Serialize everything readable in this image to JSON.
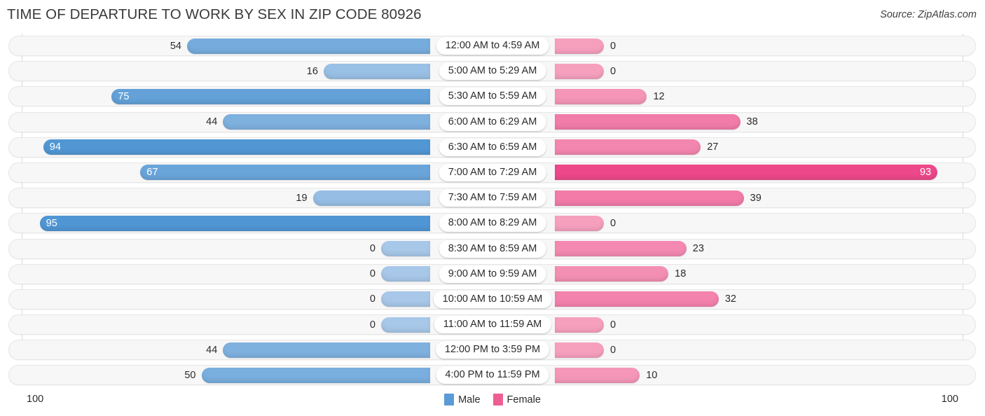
{
  "header": {
    "title": "TIME OF DEPARTURE TO WORK BY SEX IN ZIP CODE 80926",
    "source": "Source: ZipAtlas.com"
  },
  "legend": {
    "male_label": "Male",
    "female_label": "Female",
    "male_color": "#5b9bd5",
    "female_color": "#ef5e92"
  },
  "axis": {
    "left_max": "100",
    "right_max": "100"
  },
  "chart_data": {
    "type": "bar",
    "subtype": "diverging-horizontal-bar",
    "title": "TIME OF DEPARTURE TO WORK BY SEX IN ZIP CODE 80926",
    "xlabel": "",
    "ylabel": "",
    "xlim": [
      0,
      100
    ],
    "grid": false,
    "legend_position": "bottom-center",
    "categories": [
      "12:00 AM to 4:59 AM",
      "5:00 AM to 5:29 AM",
      "5:30 AM to 5:59 AM",
      "6:00 AM to 6:29 AM",
      "6:30 AM to 6:59 AM",
      "7:00 AM to 7:29 AM",
      "7:30 AM to 7:59 AM",
      "8:00 AM to 8:29 AM",
      "8:30 AM to 8:59 AM",
      "9:00 AM to 9:59 AM",
      "10:00 AM to 10:59 AM",
      "11:00 AM to 11:59 AM",
      "12:00 PM to 3:59 PM",
      "4:00 PM to 11:59 PM"
    ],
    "series": [
      {
        "name": "Male",
        "color": "#5b9bd5",
        "direction": "left",
        "values": [
          54,
          16,
          75,
          44,
          94,
          67,
          19,
          95,
          0,
          0,
          0,
          0,
          44,
          50
        ]
      },
      {
        "name": "Female",
        "color": "#ef5e92",
        "direction": "right",
        "values": [
          0,
          0,
          12,
          38,
          27,
          93,
          39,
          0,
          23,
          18,
          32,
          0,
          0,
          10
        ]
      }
    ]
  }
}
